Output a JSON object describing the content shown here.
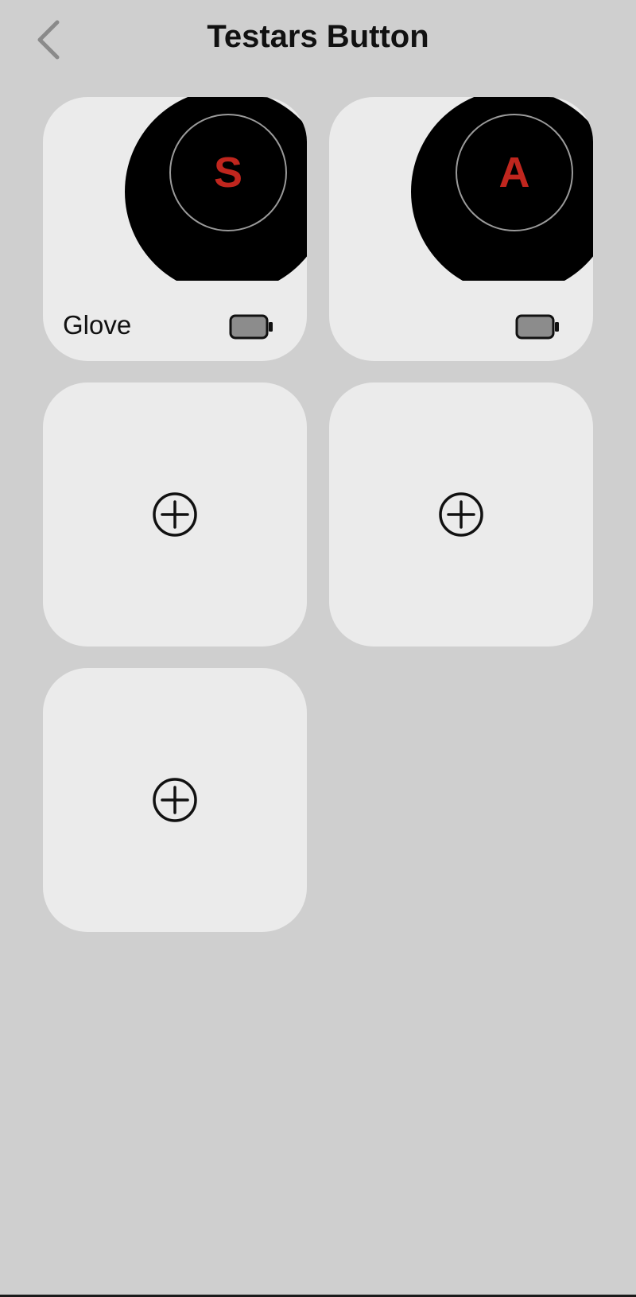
{
  "header": {
    "title": "Testars Button",
    "back_icon": "chevron-left-icon"
  },
  "devices": [
    {
      "letter": "S",
      "name": "Glove",
      "battery_icon": "battery-icon"
    },
    {
      "letter": "A",
      "name": "",
      "battery_icon": "battery-icon"
    }
  ],
  "add_slots": [
    {
      "icon": "plus-circle-icon"
    },
    {
      "icon": "plus-circle-icon"
    },
    {
      "icon": "plus-circle-icon"
    }
  ],
  "colors": {
    "background": "#cfcfcf",
    "card": "#ebebeb",
    "disc": "#000000",
    "ring": "#9a9a9a",
    "letter": "#c0261e",
    "battery_fill": "#8c8c8c"
  }
}
